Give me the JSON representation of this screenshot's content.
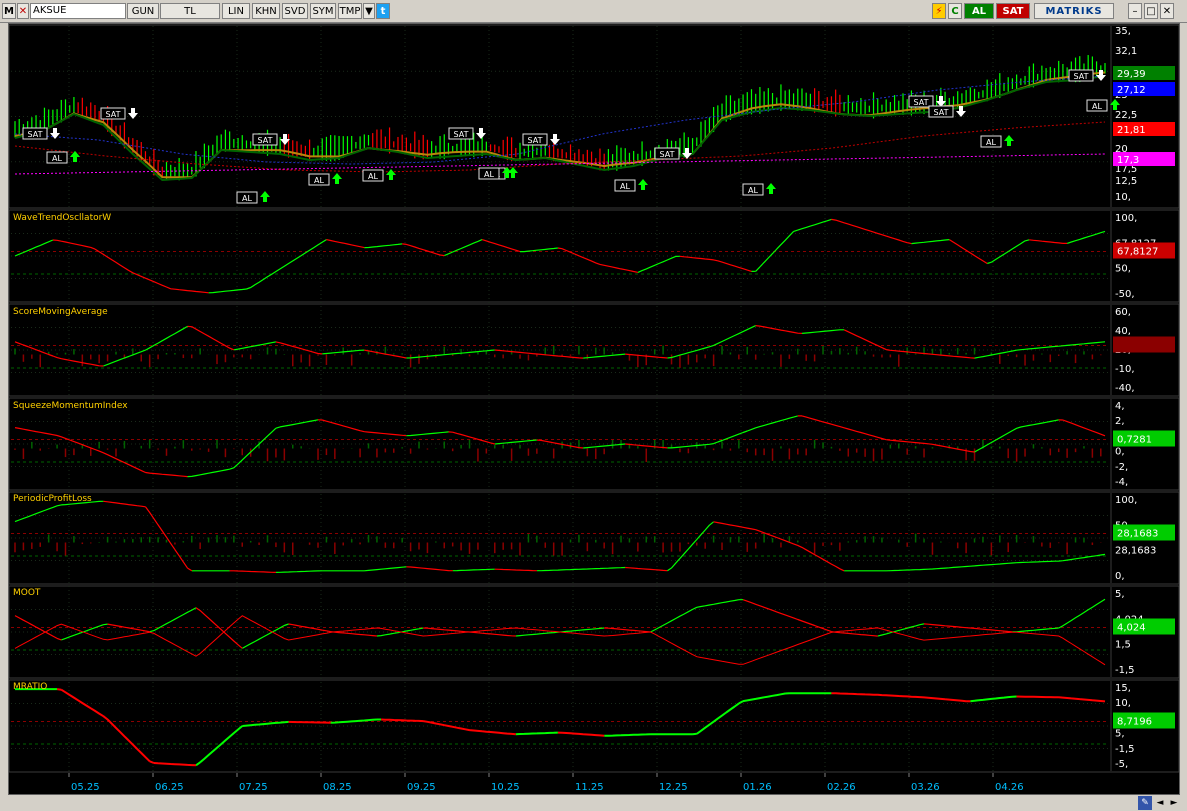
{
  "toolbar": {
    "logo": "M",
    "symbol": "AKSUE",
    "periods": [
      "GUN",
      "TL",
      "LIN",
      "KHN",
      "SVD",
      "SYM",
      "TMP"
    ],
    "buy_label": "AL",
    "sell_label": "SAT",
    "brand": "MATRIKS",
    "refresh_label": "C"
  },
  "colors": {
    "background": "#000000",
    "buy": "#00ff00",
    "sell": "#ff0000",
    "grid": "#1e3a1e",
    "label": "#ffd000"
  },
  "price_panel": {
    "scale_labels": [
      "35,",
      "32,1",
      "29,39",
      "25",
      "22,5",
      "20",
      "17,5",
      "12,5",
      "10,"
    ],
    "badges": [
      {
        "value": "29,39",
        "color": "#008000"
      },
      {
        "value": "27,12",
        "color": "#0000ff"
      },
      {
        "value": "21,81",
        "color": "#ff0000"
      },
      {
        "value": "17,3",
        "color": "#ff00ff"
      }
    ],
    "signals": [
      {
        "type": "SAT"
      },
      {
        "type": "AL"
      },
      {
        "type": "SAT"
      },
      {
        "type": "AL"
      },
      {
        "type": "SAT"
      },
      {
        "type": "AL"
      },
      {
        "type": "AL"
      },
      {
        "type": "SAT"
      },
      {
        "type": "AL"
      },
      {
        "type": "SAT"
      },
      {
        "type": "AL"
      },
      {
        "type": "SAT"
      },
      {
        "type": "AL"
      },
      {
        "type": "AL"
      },
      {
        "type": "SAT"
      },
      {
        "type": "SAT"
      },
      {
        "type": "AL"
      },
      {
        "type": "SAT"
      },
      {
        "type": "AL"
      },
      {
        "type": "AL"
      }
    ]
  },
  "indicators": [
    {
      "name": "WaveTrendOscllatorW",
      "scale": [
        "100,",
        "67,8127",
        "50,",
        "-50,"
      ],
      "badge": "67,8127",
      "badge_color": "#cc0000"
    },
    {
      "name": "ScoreMovingAverage",
      "scale": [
        "60,",
        "40,",
        "20,",
        "-10,",
        "-40,"
      ],
      "badge": "",
      "badge_color": "#8b0000"
    },
    {
      "name": "SqueezeMomentumIndex",
      "scale": [
        "4,",
        "2,",
        "0,7281",
        "0,",
        "-2,",
        "-4,"
      ],
      "badge": "0,7281",
      "badge_color": "#00cc00"
    },
    {
      "name": "PeriodicProfitLoss",
      "scale": [
        "100,",
        "50,",
        "28,1683",
        "0,"
      ],
      "badge": "28,1683",
      "badge_color": "#00cc00"
    },
    {
      "name": "MOOT",
      "scale": [
        "5,",
        "4,024",
        "1,5",
        "-1,5"
      ],
      "badge": "4,024",
      "badge_color": "#00cc00"
    },
    {
      "name": "MRATIO",
      "scale": [
        "15,",
        "10,",
        "8,7196",
        "5,",
        "-1,5",
        "-5,"
      ],
      "badge": "8,7196",
      "badge_color": "#00cc00"
    }
  ],
  "x_axis": [
    "05.25",
    "06.25",
    "07.25",
    "08.25",
    "09.25",
    "10.25",
    "11.25",
    "12.25",
    "01.26",
    "02.26",
    "03.26",
    "04.26"
  ]
}
